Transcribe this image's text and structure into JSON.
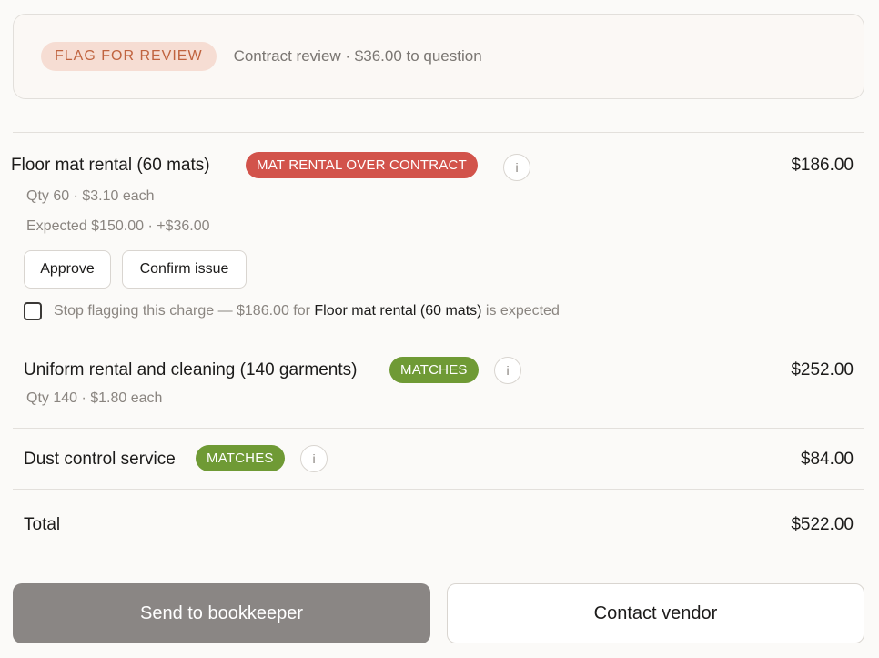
{
  "summary": {
    "status_label": "FLAG FOR REVIEW",
    "text": "Contract review · $36.00 to question"
  },
  "lines": [
    {
      "title": "Floor mat rental (60 mats)",
      "badge": "MAT RENTAL OVER CONTRACT",
      "badge_color": "#d2534b",
      "amount": "$186.00",
      "qty_text": "Qty 60 · $3.10 each",
      "expected_text": "Expected $150.00 · +$36.00",
      "approve_label": "Approve",
      "confirm_label": "Confirm issue",
      "stop_prefix": "Stop flagging this charge — $186.00 for ",
      "stop_item": "Floor mat rental (60 mats)",
      "stop_suffix": " is expected"
    },
    {
      "title": "Uniform rental and cleaning (140 garments)",
      "badge": "MATCHES",
      "badge_color": "#6f9a35",
      "amount": "$252.00",
      "qty_text": "Qty 140 · $1.80 each"
    },
    {
      "title": "Dust control service",
      "badge": "MATCHES",
      "badge_color": "#6f9a35",
      "amount": "$84.00"
    }
  ],
  "info_glyph": "i",
  "total": {
    "label": "Total",
    "amount": "$522.00"
  },
  "actions": {
    "primary": "Send to bookkeeper",
    "secondary": "Contact vendor"
  }
}
